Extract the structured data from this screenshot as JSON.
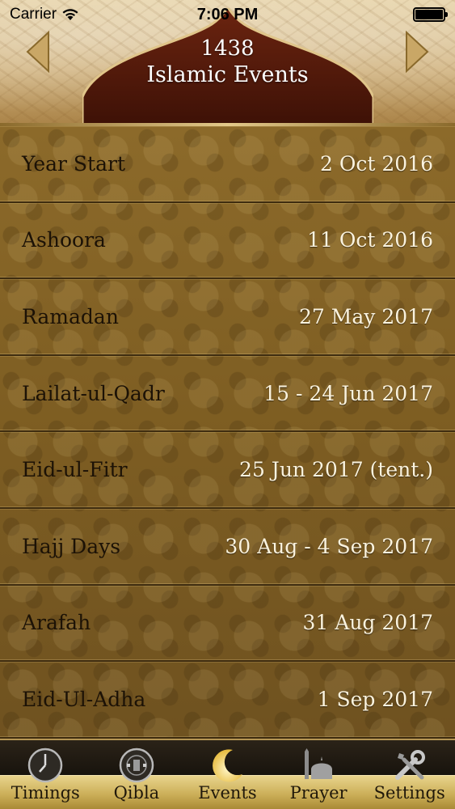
{
  "status_bar": {
    "carrier": "Carrier",
    "time": "7:06 PM"
  },
  "header": {
    "year": "1438",
    "title": "Islamic Events"
  },
  "events": [
    {
      "name": "Year Start",
      "date": "2 Oct 2016"
    },
    {
      "name": "Ashoora",
      "date": "11 Oct 2016"
    },
    {
      "name": "Ramadan",
      "date": "27 May 2017"
    },
    {
      "name": "Lailat-ul-Qadr",
      "date": "15 - 24 Jun 2017"
    },
    {
      "name": "Eid-ul-Fitr",
      "date": "25 Jun 2017 (tent.)"
    },
    {
      "name": "Hajj Days",
      "date": "30 Aug - 4 Sep 2017"
    },
    {
      "name": "Arafah",
      "date": "31 Aug 2017"
    },
    {
      "name": "Eid-Ul-Adha",
      "date": "1 Sep 2017"
    }
  ],
  "tabs": [
    {
      "label": "Timings",
      "icon": "clock-icon"
    },
    {
      "label": "Qibla",
      "icon": "compass-icon"
    },
    {
      "label": "Events",
      "icon": "crescent-icon",
      "active": true
    },
    {
      "label": "Prayer",
      "icon": "mosque-icon"
    },
    {
      "label": "Settings",
      "icon": "tools-icon"
    }
  ],
  "colors": {
    "list_background": "#7d5d22",
    "row_text": "#1c1206",
    "date_text": "#fbf3de",
    "tab_highlight": "#d8bf6a",
    "tab_bar": "#16120c"
  }
}
